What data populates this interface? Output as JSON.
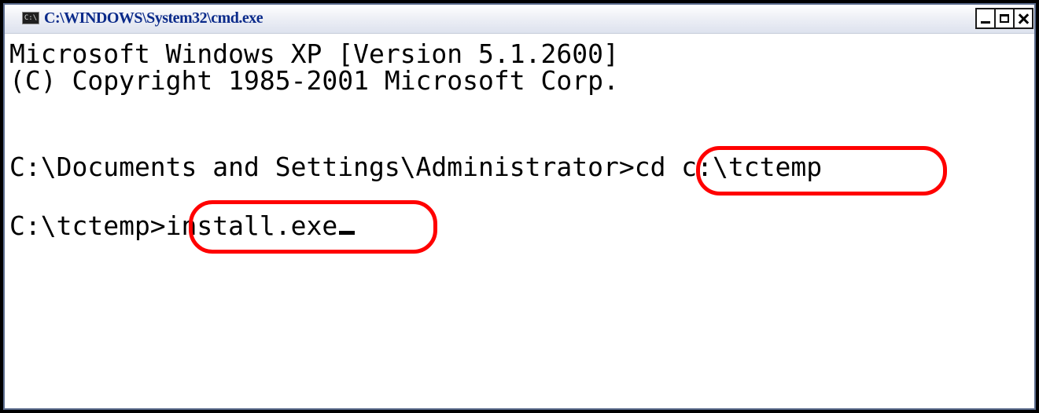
{
  "window": {
    "title": "C:\\WINDOWS\\System32\\cmd.exe",
    "icon_label": "C:\\"
  },
  "controls": {
    "minimize": "minimize",
    "maximize": "maximize",
    "close": "close"
  },
  "console": {
    "lines": [
      "Microsoft Windows XP [Version 5.1.2600]",
      "(C) Copyright 1985-2001 Microsoft Corp.",
      "C:\\Documents and Settings\\Administrator>cd c:\\tctemp",
      "C:\\tctemp>install.exe"
    ]
  },
  "highlights": [
    {
      "target": "cd c:\\tctemp",
      "color": "#ff0000"
    },
    {
      "target": "install.exe",
      "color": "#ff0000"
    }
  ],
  "colors": {
    "title_text": "#0a2a8a",
    "console_bg": "#ffffff",
    "console_text": "#000000",
    "highlight": "#ff0000"
  }
}
